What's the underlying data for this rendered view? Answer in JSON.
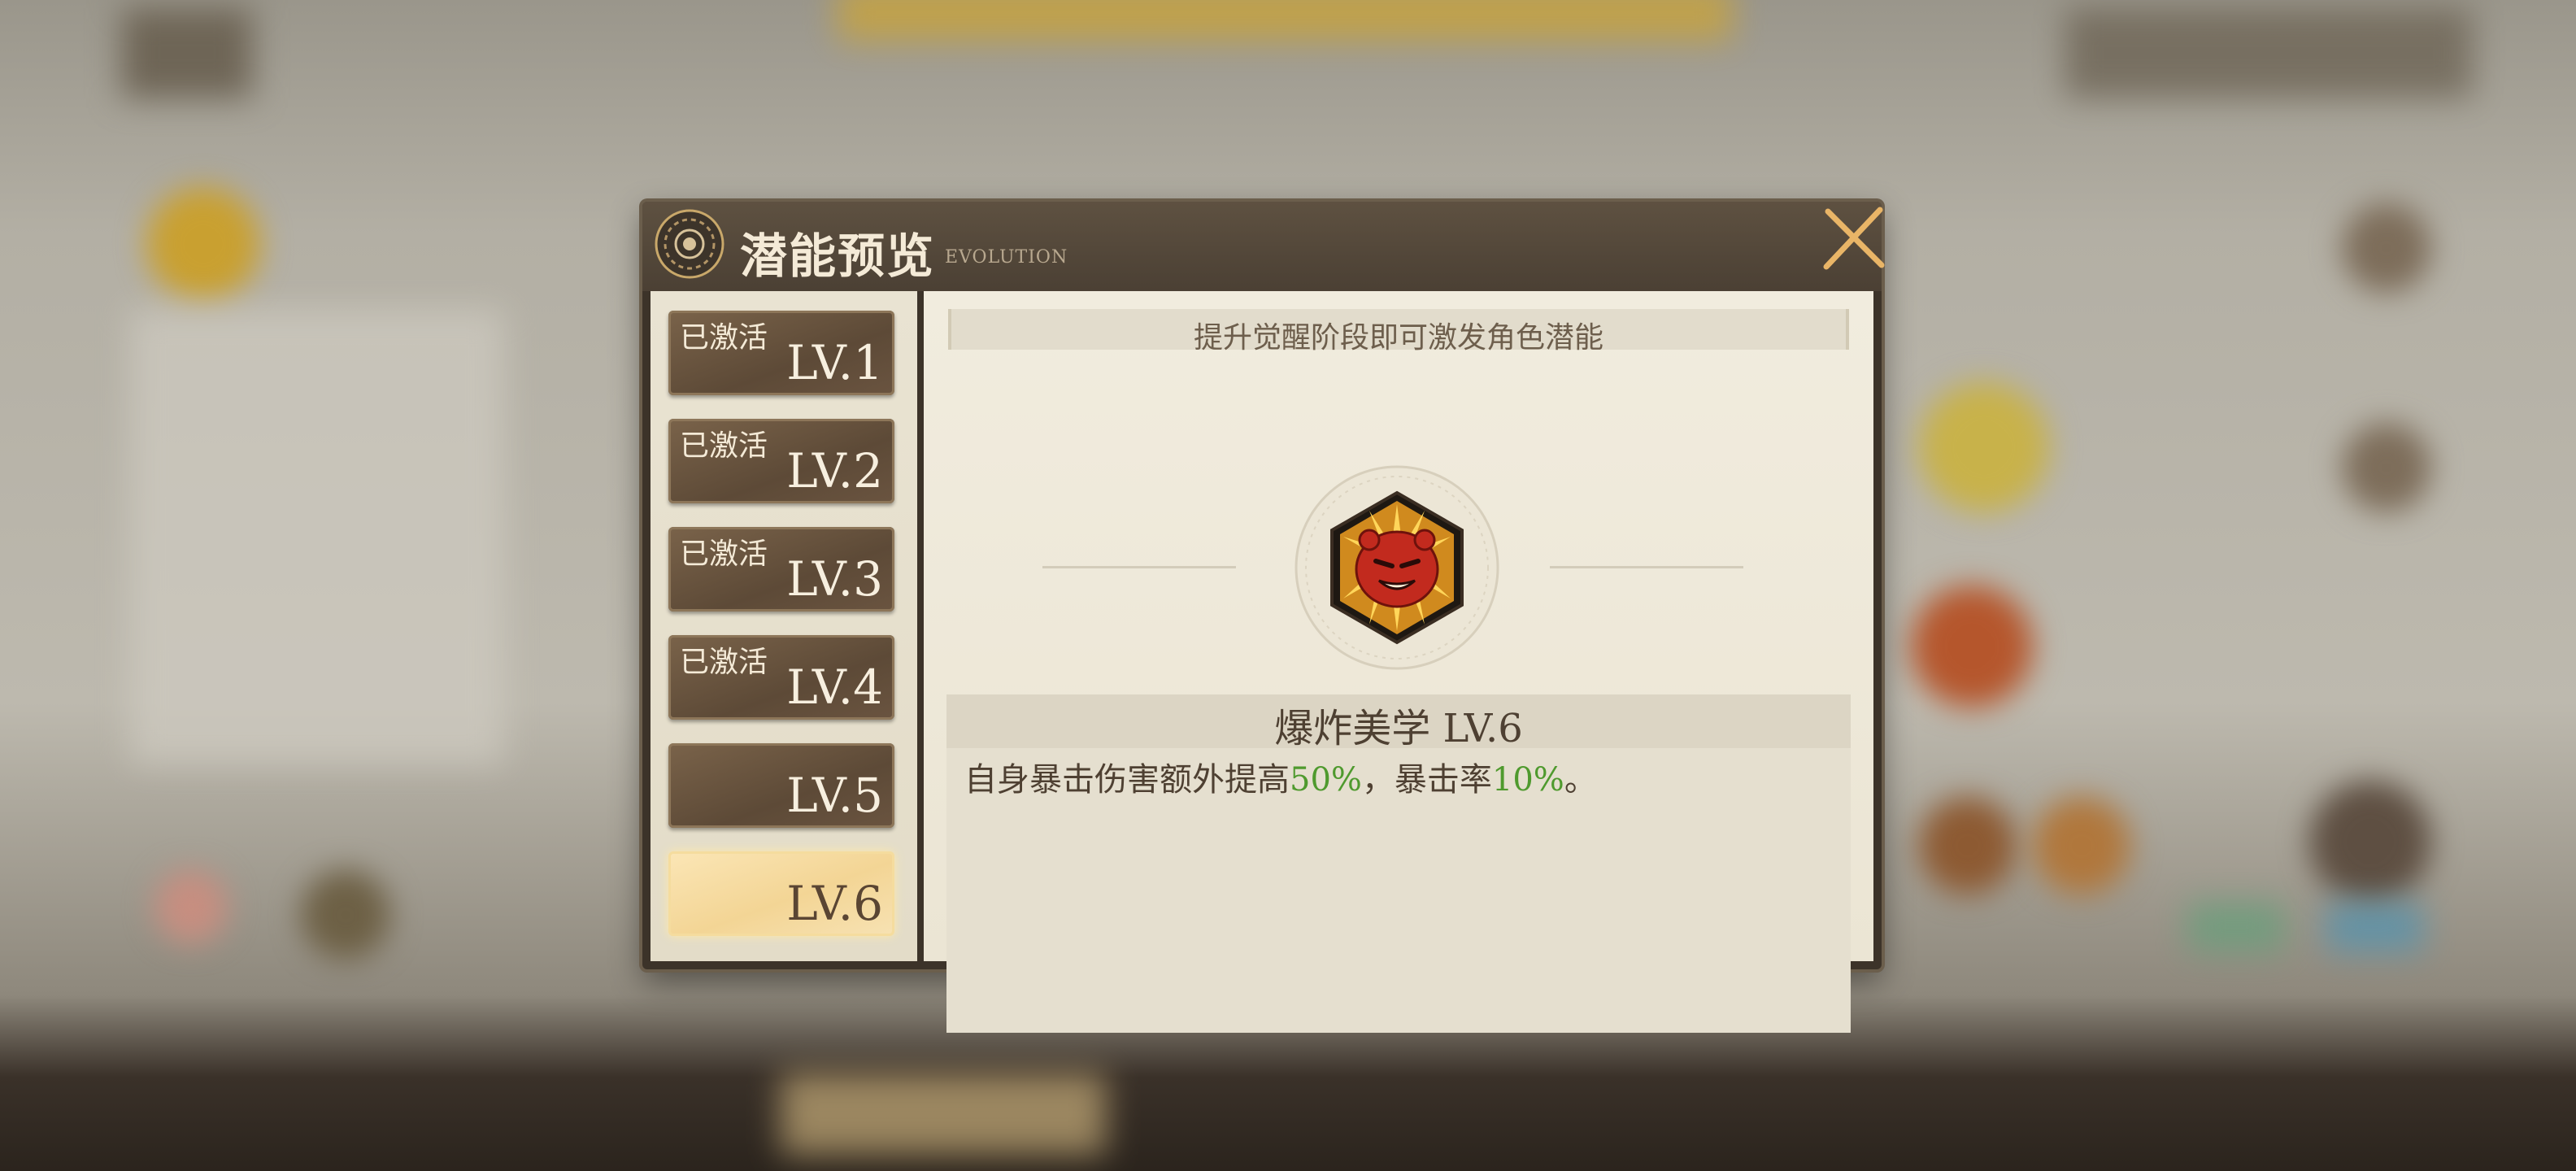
{
  "dialog": {
    "title": "潜能预览",
    "subtitle": "EVOLUTION",
    "hint": "提升觉醒阶段即可激发角色潜能"
  },
  "levels": [
    {
      "status": "已激活",
      "label": "LV.1"
    },
    {
      "status": "已激活",
      "label": "LV.2"
    },
    {
      "status": "已激活",
      "label": "LV.3"
    },
    {
      "status": "已激活",
      "label": "LV.4"
    },
    {
      "status": "",
      "label": "LV.5"
    },
    {
      "status": "",
      "label": "LV.6"
    }
  ],
  "selected_level": "LV.6",
  "skill": {
    "name": "爆炸美学  LV.6",
    "icon": "exploding-red-creature-hexagon-icon",
    "desc_prefix": "自身暴击伤害额外提高",
    "value1": "50%",
    "desc_mid": "，暴击率",
    "value2": "10%",
    "desc_suffix": "。"
  },
  "colors": {
    "highlight_green": "#4f9a2e",
    "frame_brown": "#4b4034",
    "selected_gold": "#f3d595"
  }
}
